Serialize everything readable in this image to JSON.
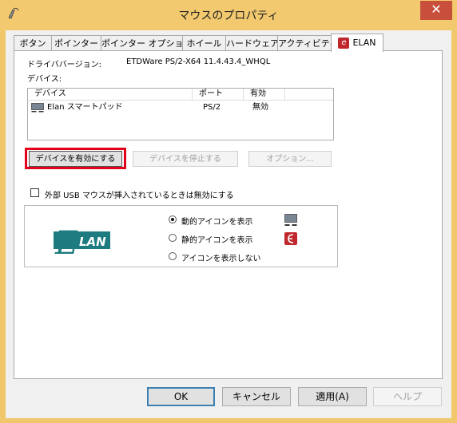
{
  "window": {
    "title": "マウスのプロパティ",
    "close_glyph": "✕"
  },
  "tabs": [
    {
      "label": "ボタン"
    },
    {
      "label": "ポインター"
    },
    {
      "label": "ポインター オプション"
    },
    {
      "label": "ホイール"
    },
    {
      "label": "ハードウェア"
    },
    {
      "label": "アクティビティ"
    },
    {
      "label": "ELAN",
      "icon": "elan-tab-icon",
      "active": true
    }
  ],
  "driver": {
    "label": "ドライババージョン:",
    "value": "ETDWare PS/2-X64 11.4.43.4_WHQL"
  },
  "devices": {
    "label": "デバイス:",
    "columns": [
      "デバイス",
      "ポート",
      "有効"
    ],
    "rows": [
      {
        "device": "Elan スマートパッド",
        "port": "PS/2",
        "enabled": "無効",
        "icon": "touchpad-icon"
      }
    ]
  },
  "device_buttons": {
    "enable": "デバイスを有効にする",
    "disable": "デバイスを停止する",
    "options": "オプション..."
  },
  "usb_option": {
    "label": "外部 USB マウスが挿入されているときは無効にする",
    "checked": false
  },
  "logo": {
    "text": "LAN",
    "initial": "E",
    "colors": {
      "primary": "#1e7b7f",
      "background": "#ffffff"
    }
  },
  "tray_icon": {
    "options": [
      {
        "label": "動的アイコンを表示",
        "selected": true,
        "icon": "touchpad-icon"
      },
      {
        "label": "静的アイコンを表示",
        "selected": false,
        "icon": "elan-red-icon"
      },
      {
        "label": "アイコンを表示しない",
        "selected": false
      }
    ]
  },
  "footer": {
    "ok": "OK",
    "cancel": "キャンセル",
    "apply": "適用(A)",
    "help": "ヘルプ"
  },
  "colors": {
    "titlebar": "#f2c96e",
    "highlight_outline": "#e3001b",
    "elan_red": "#c0282d",
    "elan_teal": "#1e7b7f"
  }
}
